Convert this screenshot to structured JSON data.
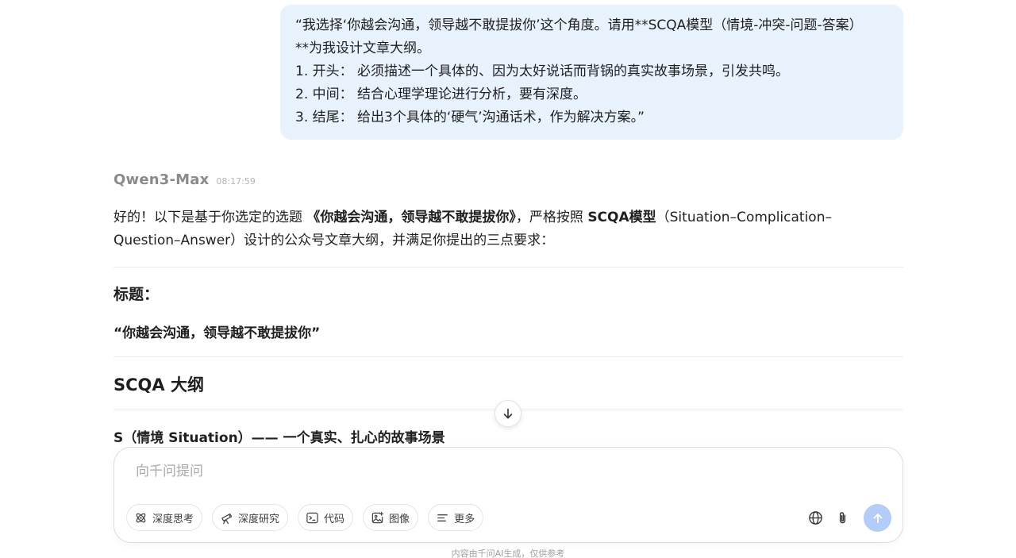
{
  "user_message": {
    "lines": [
      "“我选择‘你越会沟通，领导越不敢提拔你’这个角度。请用**SCQA模型（情境-冲突-问题-答案）",
      "**为我设计文章大纲。",
      "1. 开头： 必须描述一个具体的、因为太好说话而背锅的真实故事场景，引发共鸣。",
      "2. 中间： 结合心理学理论进行分析，要有深度。",
      "3. 结尾： 给出3个具体的‘硬气’沟通话术，作为解决方案。”"
    ]
  },
  "assistant": {
    "model_name": "Qwen3-Max",
    "timestamp": "08:17:59",
    "intro": {
      "part1": "好的！以下是基于你选定的选题 ",
      "topic_bold": "《你越会沟通，领导越不敢提拔你》",
      "part2": "，严格按照 ",
      "model_bold": "SCQA模型",
      "part3": "（Situation–Complication–",
      "part4": "Question–Answer）设计的公众号文章大纲，并满足你提出的三点要求："
    },
    "title_label": "标题：",
    "title_quote": "“你越会沟通，领导越不敢提拔你”",
    "outline_heading": "SCQA 大纲",
    "section_s_heading": "S（情境 Situation）—— 一个真实、扎心的故事场景"
  },
  "composer": {
    "placeholder": "向千问提问",
    "tools": [
      {
        "label": "深度思考",
        "icon": "atom-icon"
      },
      {
        "label": "深度研究",
        "icon": "telescope-icon"
      },
      {
        "label": "代码",
        "icon": "terminal-icon"
      },
      {
        "label": "图像",
        "icon": "image-icon"
      },
      {
        "label": "更多",
        "icon": "menu-lines-icon"
      }
    ],
    "right_icons": [
      "globe-icon",
      "paperclip-icon",
      "send-arrow-icon"
    ]
  },
  "footer_note": "内容由千问AI生成，仅供参考",
  "colors": {
    "user_bubble_bg": "#e8f2fd",
    "send_button_bg": "#b3cdfb",
    "model_name": "#8a8a8a",
    "placeholder": "#a8a8a8"
  }
}
